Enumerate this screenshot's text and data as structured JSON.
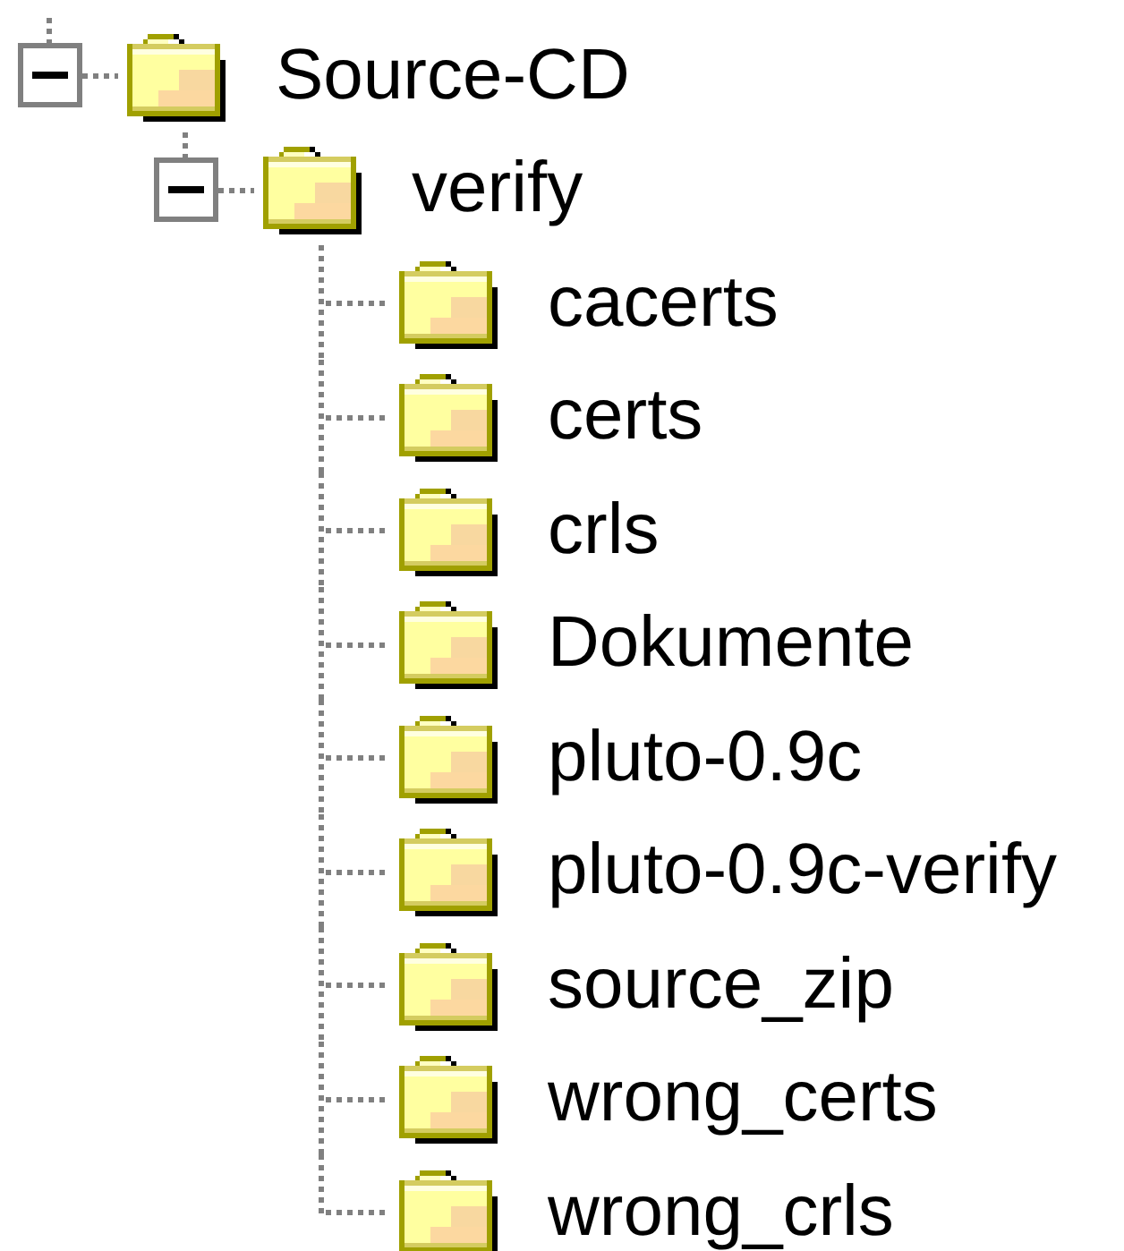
{
  "tree": [
    {
      "label": "Source-CD",
      "expanded": true,
      "children": [
        {
          "label": "verify",
          "expanded": true,
          "children": [
            {
              "label": "cacerts"
            },
            {
              "label": "certs"
            },
            {
              "label": "crls"
            },
            {
              "label": "Dokumente"
            },
            {
              "label": "pluto-0.9c"
            },
            {
              "label": "pluto-0.9c-verify"
            },
            {
              "label": "source_zip"
            },
            {
              "label": "wrong_certs"
            },
            {
              "label": "wrong_crls"
            }
          ]
        }
      ]
    }
  ]
}
